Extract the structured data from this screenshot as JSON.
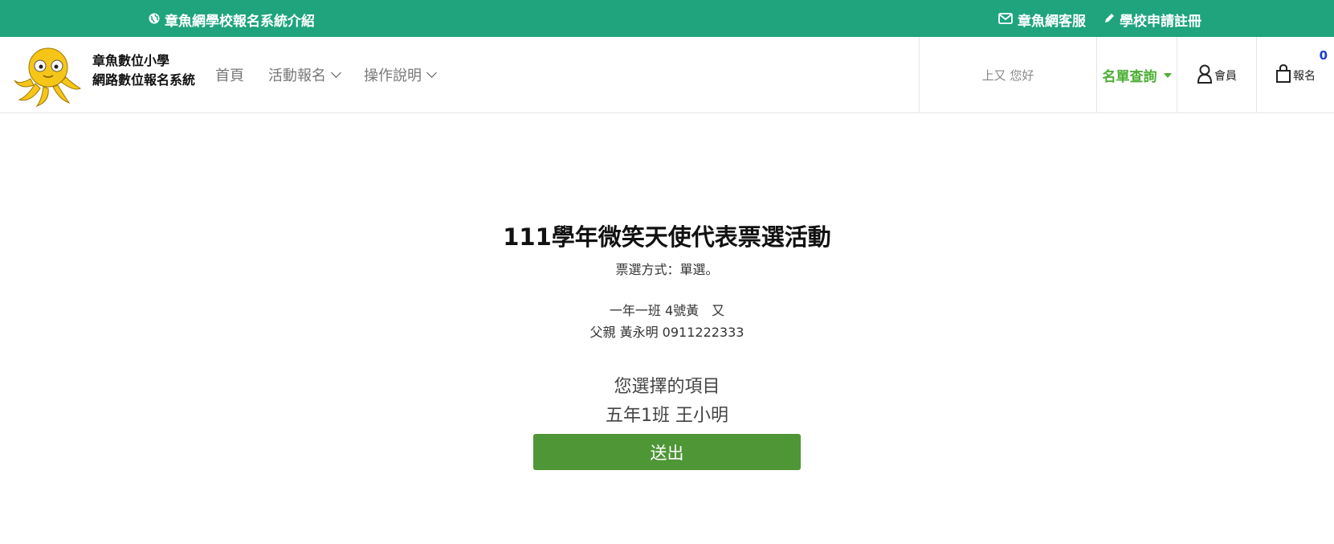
{
  "topbar": {
    "intro_label": "章魚網學校報名系統介紹",
    "service_label": "章魚網客服",
    "register_label": "學校申請註冊"
  },
  "header": {
    "site_name_line1": "章魚數位小學",
    "site_name_line2": "網路數位報名系統",
    "nav": [
      "首頁",
      "活動報名",
      "操作說明"
    ],
    "greeting": "上又 您好",
    "query_label": "名單查詢",
    "member_label": "會員",
    "cart_label": "報名",
    "cart_count": "0"
  },
  "main": {
    "title": "111學年微笑天使代表票選活動",
    "method": "票選方式：單選。",
    "voter_line1": "一年一班 4號黃　又",
    "voter_line2": "父親 黃永明 0911222333",
    "selected_label": "您選擇的項目",
    "selected_value": "五年1班 王小明",
    "submit_label": "送出"
  },
  "colors": {
    "topbar": "#1fa47e",
    "accent_green": "#4caf35",
    "submit_button": "#4e9636",
    "cart_badge": "#1a3fd0",
    "logo_body": "#f5c518"
  }
}
